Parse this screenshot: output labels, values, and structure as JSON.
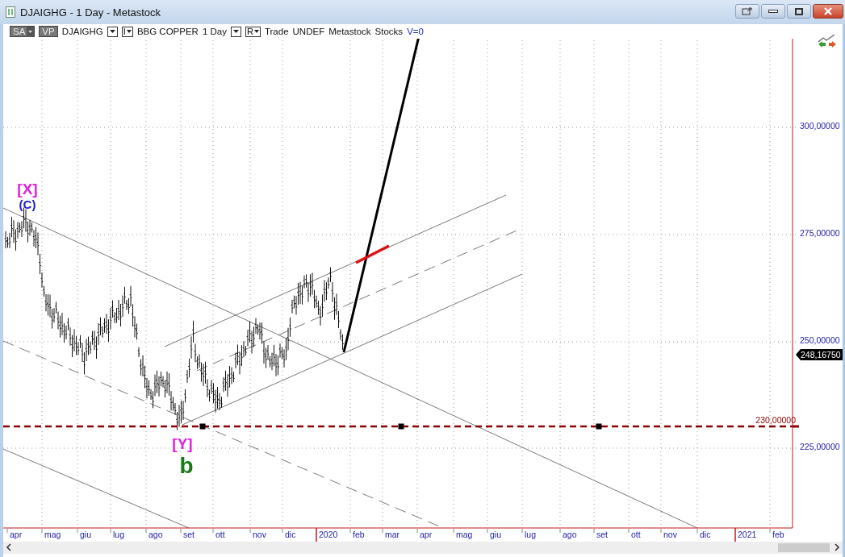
{
  "window": {
    "title": "DJAIGHG - 1 Day - Metastock"
  },
  "toolbar": {
    "items": [
      {
        "kind": "dark_dropdown",
        "label": "SA"
      },
      {
        "kind": "dark_button",
        "label": "VP"
      },
      {
        "kind": "text",
        "label": "DJAIGHG"
      },
      {
        "kind": "dropdown"
      },
      {
        "kind": "box_dropdown",
        "label": "I"
      },
      {
        "kind": "text",
        "label": "BBG COPPER"
      },
      {
        "kind": "text",
        "label": "1 Day"
      },
      {
        "kind": "dropdown"
      },
      {
        "kind": "box_dropdown",
        "label": "R"
      },
      {
        "kind": "text",
        "label": "Trade"
      },
      {
        "kind": "text",
        "label": "UNDEF"
      },
      {
        "kind": "text",
        "label": "Metastock"
      },
      {
        "kind": "text",
        "label": "Stocks"
      },
      {
        "kind": "value",
        "label": "V=0"
      }
    ]
  },
  "chart": {
    "y_axis_labels": [
      "300,00000",
      "275,00000",
      "250,00000",
      "225,00000"
    ],
    "last_price": "248,16750",
    "level_line_label": "230,00000",
    "wave_labels": [
      {
        "text": "[X]",
        "color": "#e020e0"
      },
      {
        "text": "(C)",
        "color": "#1a1acc"
      },
      {
        "text": "[Y]",
        "color": "#e020e0"
      },
      {
        "text": "b",
        "color": "#1a7a1a"
      }
    ],
    "x_axis_labels": [
      {
        "label": "apr",
        "year": false
      },
      {
        "label": "mag",
        "year": false
      },
      {
        "label": "giu",
        "year": false
      },
      {
        "label": "lug",
        "year": false
      },
      {
        "label": "ago",
        "year": false
      },
      {
        "label": "set",
        "year": false
      },
      {
        "label": "ott",
        "year": false
      },
      {
        "label": "nov",
        "year": false
      },
      {
        "label": "dic",
        "year": false
      },
      {
        "label": "2020",
        "year": true
      },
      {
        "label": "feb",
        "year": false
      },
      {
        "label": "mar",
        "year": false
      },
      {
        "label": "apr",
        "year": false
      },
      {
        "label": "mag",
        "year": false
      },
      {
        "label": "giu",
        "year": false
      },
      {
        "label": "lug",
        "year": false
      },
      {
        "label": "ago",
        "year": false
      },
      {
        "label": "set",
        "year": false
      },
      {
        "label": "ott",
        "year": false
      },
      {
        "label": "nov",
        "year": false
      },
      {
        "label": "dic",
        "year": false
      },
      {
        "label": "2021",
        "year": true
      },
      {
        "label": "feb",
        "year": false
      }
    ]
  }
}
